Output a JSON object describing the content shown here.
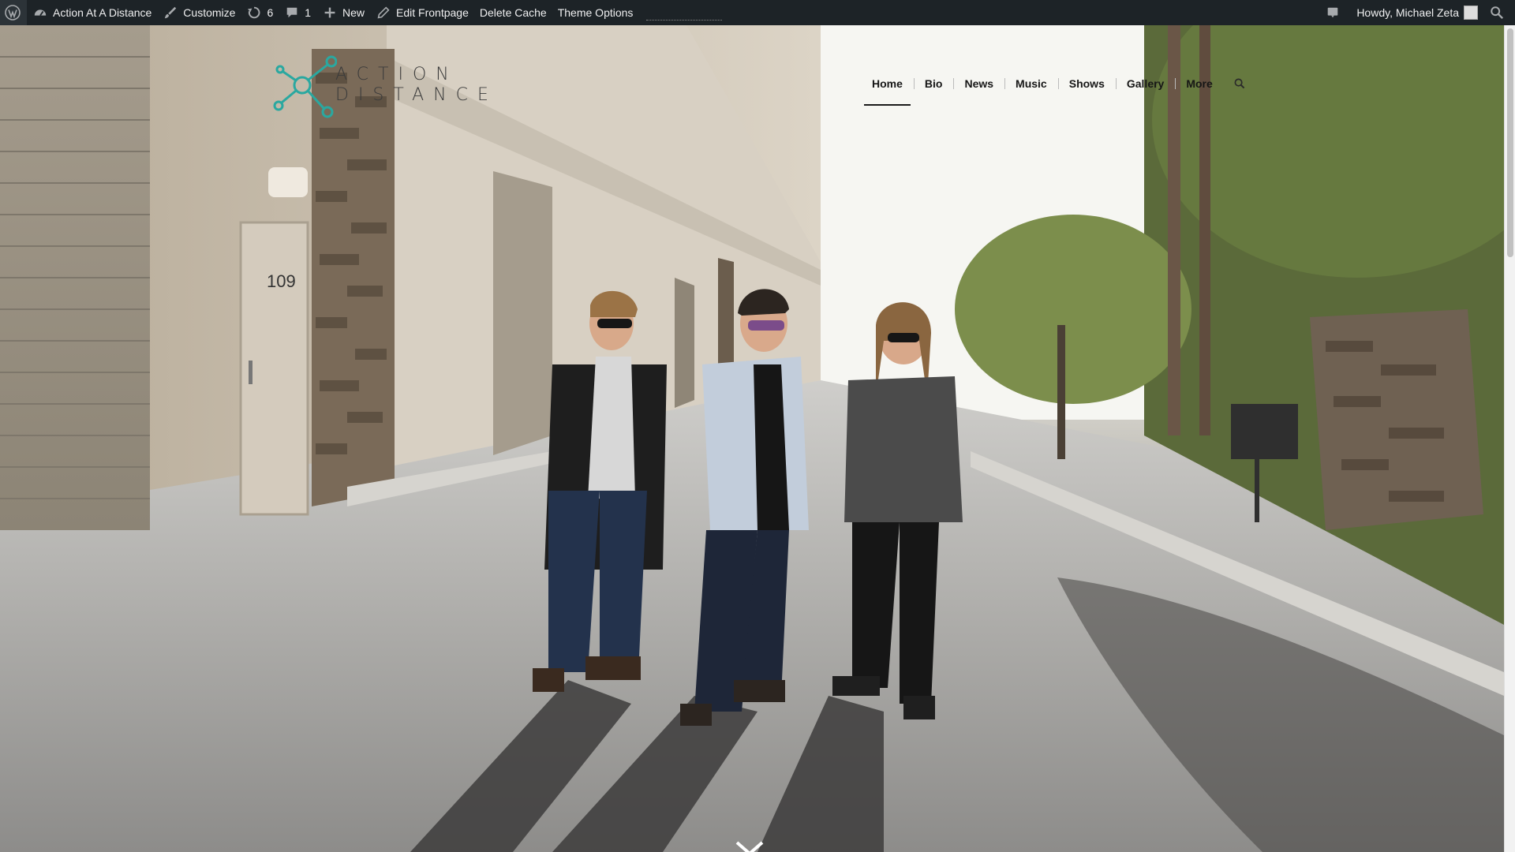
{
  "adminbar": {
    "site_name": "Action At A Distance",
    "customize": "Customize",
    "updates_count": "6",
    "comments_count": "1",
    "new_label": "New",
    "edit_frontpage": "Edit Frontpage",
    "delete_cache": "Delete Cache",
    "theme_options": "Theme Options",
    "howdy": "Howdy, Michael Zeta"
  },
  "site": {
    "logo_text_line1": "ACTION",
    "logo_text_line2": "DISTANCE",
    "nav": [
      {
        "label": "Home",
        "active": true
      },
      {
        "label": "Bio"
      },
      {
        "label": "News"
      },
      {
        "label": "Music"
      },
      {
        "label": "Shows"
      },
      {
        "label": "Gallery"
      },
      {
        "label": "More"
      }
    ]
  },
  "hero": {
    "door_number": "109"
  },
  "colors": {
    "adminbar_bg": "#1d2327",
    "logo_accent": "#2aa8a0",
    "nav_text": "#161616"
  },
  "icons": [
    "wordpress-icon",
    "dashboard-icon",
    "brush-icon",
    "updates-icon",
    "comment-icon",
    "plus-icon",
    "pencil-icon",
    "notification-icon",
    "search-icon",
    "chevron-down-icon"
  ]
}
